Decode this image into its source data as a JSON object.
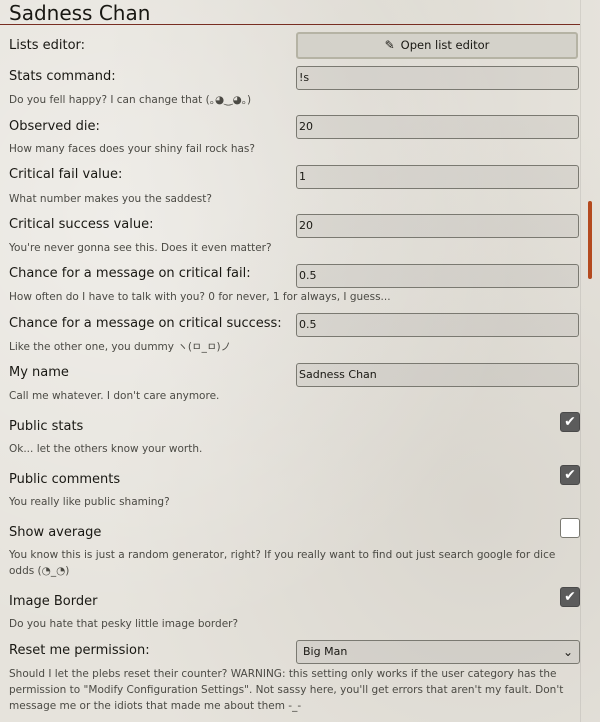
{
  "title": "Sadness Chan",
  "settings": [
    {
      "label": "Lists editor:",
      "button": "Open list editor",
      "icon": "edit-icon"
    },
    {
      "label": "Stats command:",
      "value": "!s",
      "hint": "Do you fell happy? I can change that (｡◕‿◕｡)"
    },
    {
      "label": "Observed die:",
      "value": "20",
      "hint": "How many faces does your shiny fail rock has?"
    },
    {
      "label": "Critical fail value:",
      "value": "1",
      "hint": "What number makes you the saddest?"
    },
    {
      "label": "Critical success value:",
      "value": "20",
      "hint": "You're never gonna see this. Does it even matter?"
    },
    {
      "label": "Chance for a message on critical fail:",
      "value": "0.5",
      "hint": "How often do I have to talk with you? 0 for never, 1 for always, I guess..."
    },
    {
      "label": "Chance for a message on critical success:",
      "value": "0.5",
      "hint": "Like the other one, you dummy ヽ(ㅁ_ㅁ)ノ"
    },
    {
      "label": "My name",
      "value": "Sadness Chan",
      "hint": "Call me whatever. I don't care anymore."
    },
    {
      "label": "Public stats",
      "checked": true,
      "hint": "Ok... let the others know your worth."
    },
    {
      "label": "Public comments",
      "checked": true,
      "hint": "You really like public shaming?"
    },
    {
      "label": "Show average",
      "checked": false,
      "hint": "You know this is just a random generator, right? If you really want to find out just search google for dice odds (◔_◔)"
    },
    {
      "label": "Image Border",
      "checked": true,
      "hint": "Do you hate that pesky little image border?"
    },
    {
      "label": "Reset me permission:",
      "selected": "Big Man",
      "hint": "Should I let the plebs reset their counter? WARNING: this setting only works if the user category has the permission to \"Modify Configuration Settings\". Not sassy here, you'll get errors that aren't my fault. Don't message me or the idiots that made me about them -_-"
    }
  ],
  "checkmark": "✔",
  "chevron": "⌄",
  "edit_icon": "✎"
}
